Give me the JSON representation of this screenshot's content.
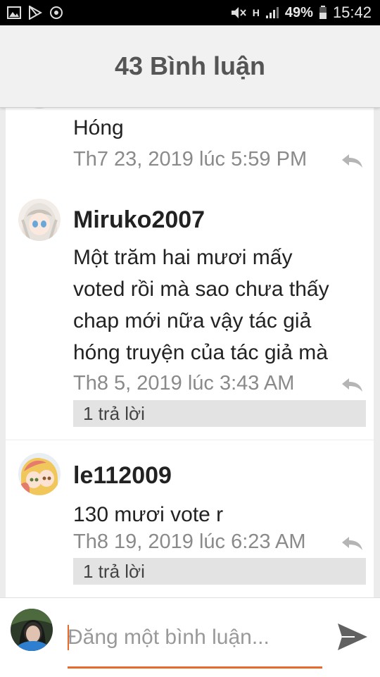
{
  "status_bar": {
    "icons_left": [
      "image-icon",
      "play-store-icon",
      "location-icon"
    ],
    "icons_right": [
      "mute-icon",
      "h-signal-icon",
      "signal-bars-icon",
      "battery-icon"
    ],
    "network_label": "H",
    "battery": "49%",
    "time": "15:42"
  },
  "header": {
    "title": "43 Bình luận"
  },
  "comments": [
    {
      "author": "",
      "text": "Hóng",
      "timestamp": "Th7 23, 2019 lúc 5:59 PM",
      "replies": ""
    },
    {
      "author": "Miruko2007",
      "text": "Một trăm hai mươi mấy voted rồi mà sao chưa thấy chap mới nữa vậy tác giả hóng truyện của tác giả mà",
      "lines": [
        "Một trăm hai mươi mấy",
        "voted rồi mà sao chưa thấy",
        "chap mới nữa vậy tác giả",
        "hóng truyện của tác giả mà"
      ],
      "timestamp": "Th8 5, 2019 lúc 3:43 AM",
      "replies": "1 trả lời"
    },
    {
      "author": "le112009",
      "text": "130 mươi vote r",
      "timestamp": "Th8 19, 2019 lúc 6:23 AM",
      "replies": "1 trả lời"
    }
  ],
  "composer": {
    "placeholder": "Đăng một bình luận...",
    "value": ""
  },
  "colors": {
    "accent": "#e8692c",
    "header_bg": "#f1f1f1",
    "meta_text": "#8a8a8a"
  }
}
